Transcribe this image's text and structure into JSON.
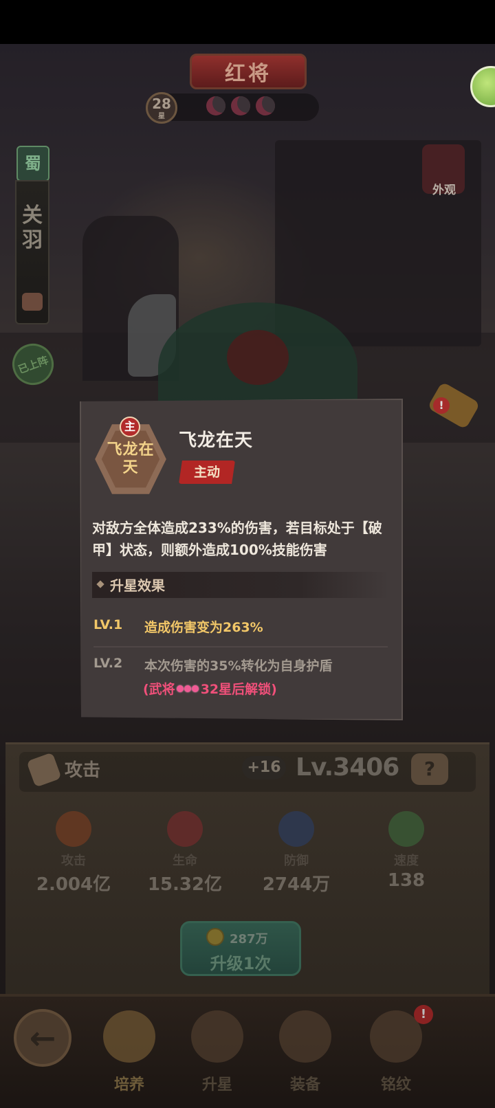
{
  "header": {
    "rank_label": "红将",
    "stars": "28",
    "stars_unit": "星"
  },
  "hero": {
    "faction": "蜀",
    "name": "关羽",
    "status_badge": "已上阵"
  },
  "right_side": {
    "skin_label": "外观"
  },
  "skill_popup": {
    "badge": "主",
    "icon_text": "飞龙在天",
    "name": "飞龙在天",
    "type": "主动",
    "description": "对敌方全体造成233%的伤害，若目标处于【破甲】状态，则额外造成100%技能伤害",
    "section_title": "升星效果",
    "levels": [
      {
        "tag": "LV.1",
        "text": "造成伤害变为263%"
      },
      {
        "tag": "LV.2",
        "text": "本次伤害的35%转化为自身护盾"
      }
    ],
    "unlock_prefix": "(武将",
    "unlock_suffix": "32星后解锁)"
  },
  "attribute": {
    "label": "攻击",
    "bonus": "+16",
    "level": "Lv.3406",
    "help": "?"
  },
  "stats": [
    {
      "label": "攻击",
      "value": "2.004亿",
      "icon": "attack-icon"
    },
    {
      "label": "生命",
      "value": "15.32亿",
      "icon": "health-icon"
    },
    {
      "label": "防御",
      "value": "2744万",
      "icon": "defense-icon"
    },
    {
      "label": "速度",
      "value": "138",
      "icon": "speed-icon"
    }
  ],
  "upgrade": {
    "cost": "287万",
    "label": "升级1次"
  },
  "nav": {
    "back": "←",
    "tabs": [
      "培养",
      "升星",
      "装备",
      "铭纹"
    ],
    "alert": "!"
  }
}
